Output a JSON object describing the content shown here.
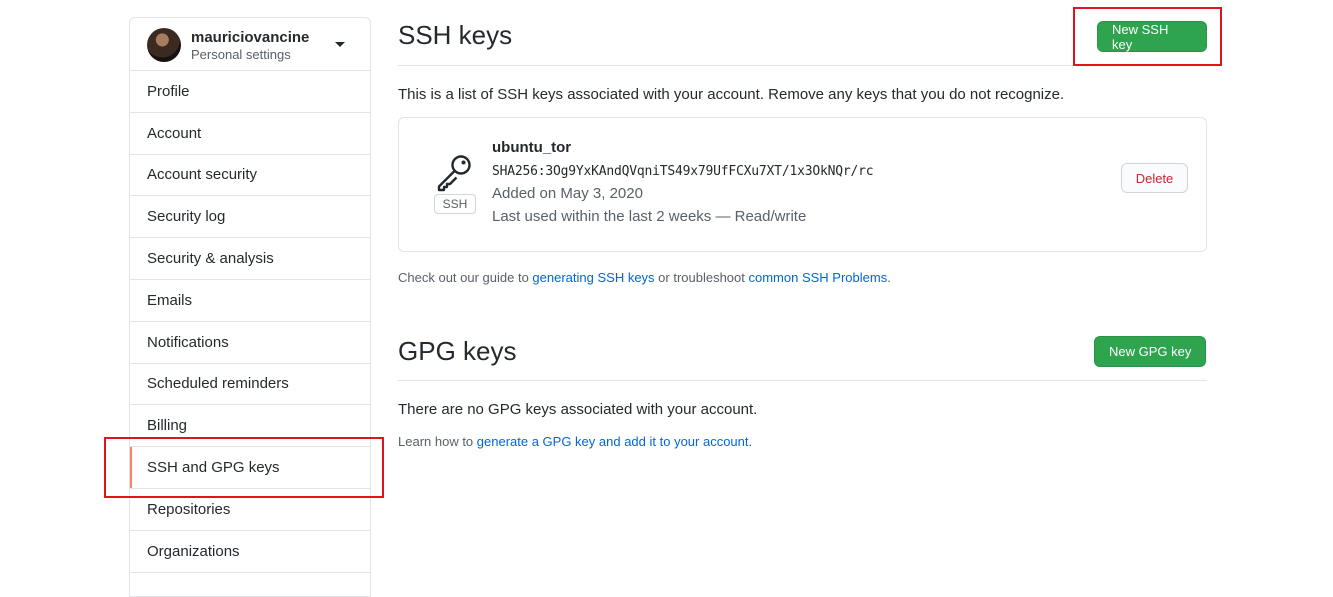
{
  "sidebar": {
    "username": "mauriciovancine",
    "subtitle": "Personal settings",
    "items": [
      {
        "label": "Profile"
      },
      {
        "label": "Account"
      },
      {
        "label": "Account security"
      },
      {
        "label": "Security log"
      },
      {
        "label": "Security & analysis"
      },
      {
        "label": "Emails"
      },
      {
        "label": "Notifications"
      },
      {
        "label": "Scheduled reminders"
      },
      {
        "label": "Billing"
      },
      {
        "label": "SSH and GPG keys",
        "selected": true
      },
      {
        "label": "Repositories"
      },
      {
        "label": "Organizations"
      }
    ]
  },
  "ssh": {
    "title": "SSH keys",
    "new_button": "New SSH key",
    "description": "This is a list of SSH keys associated with your account. Remove any keys that you do not recognize.",
    "key": {
      "type_label": "SSH",
      "name": "ubuntu_tor",
      "fingerprint": "SHA256:3Og9YxKAndQVqniTS49x79UfFCXu7XT/1x3OkNQr/rc",
      "added": "Added on May 3, 2020",
      "last_used": "Last used within the last 2 weeks — Read/write",
      "delete_button": "Delete"
    },
    "guide": {
      "prefix": "Check out our guide to ",
      "link1": "generating SSH keys",
      "middle": " or troubleshoot ",
      "link2": "common SSH Problems",
      "suffix": "."
    }
  },
  "gpg": {
    "title": "GPG keys",
    "new_button": "New GPG key",
    "empty_text": "There are no GPG keys associated with your account.",
    "learn": {
      "prefix": "Learn how to ",
      "link": "generate a GPG key and add it to your account",
      "suffix": "."
    }
  },
  "colors": {
    "accent_green": "#2ea44f",
    "link_blue": "#0366d6",
    "danger_red": "#cb2431",
    "selected_marker": "#f9826c",
    "annotation_red": "#e0141e"
  },
  "icons": [
    "key-icon",
    "caret-down-icon"
  ]
}
